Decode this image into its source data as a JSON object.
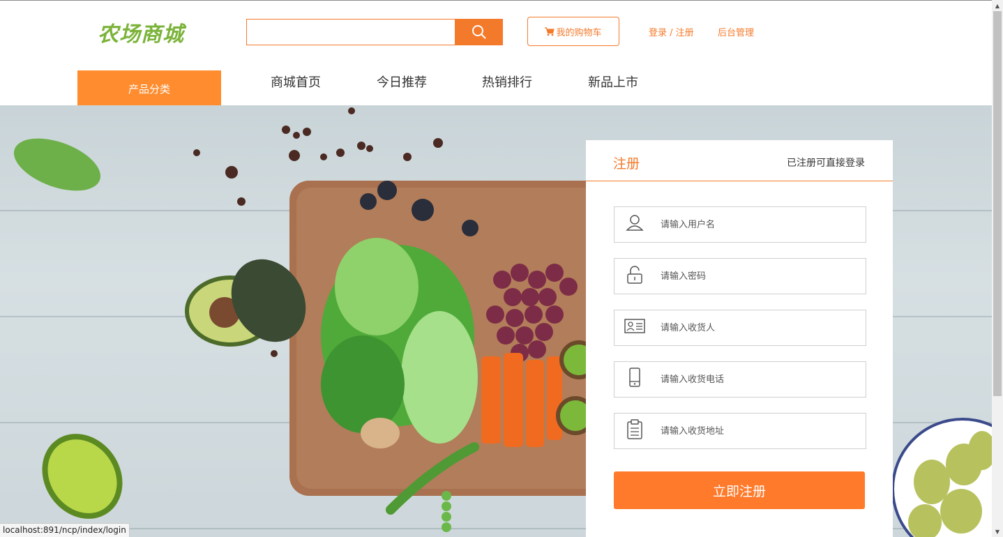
{
  "header": {
    "logo": "农场商城",
    "search": {
      "value": "",
      "placeholder": ""
    },
    "cart_label": "我的购物车",
    "login_label": "登录 / 注册",
    "admin_label": "后台管理"
  },
  "nav": {
    "category_label": "产品分类",
    "items": [
      "商城首页",
      "今日推荐",
      "热销排行",
      "新品上市"
    ]
  },
  "register": {
    "title": "注册",
    "hint": "已注册可直接登录",
    "fields": [
      {
        "icon": "user-icon",
        "placeholder": "请输入用户名"
      },
      {
        "icon": "lock-icon",
        "placeholder": "请输入密码"
      },
      {
        "icon": "id-card-icon",
        "placeholder": "请输入收货人"
      },
      {
        "icon": "phone-icon",
        "placeholder": "请输入收货电话"
      },
      {
        "icon": "clipboard-icon",
        "placeholder": "请输入收货地址"
      }
    ],
    "submit_label": "立即注册"
  },
  "status_url": "localhost:891/ncp/index/login",
  "colors": {
    "accent": "#f47a2b",
    "category_bg": "#ff8c2e",
    "logo": "#7bb33a",
    "submit": "#ff7a2a"
  }
}
